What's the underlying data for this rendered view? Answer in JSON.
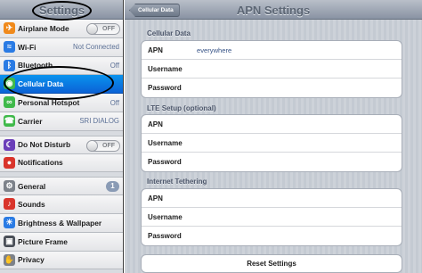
{
  "sidebar": {
    "title": "Settings",
    "items": [
      {
        "label": "Airplane Mode",
        "icon": "airplane-icon",
        "toggle": "OFF"
      },
      {
        "label": "Wi-Fi",
        "icon": "wifi-icon",
        "value": "Not Connected"
      },
      {
        "label": "Bluetooth",
        "icon": "bluetooth-icon",
        "value": "Off"
      },
      {
        "label": "Cellular Data",
        "icon": "cellular-icon",
        "selected": true
      },
      {
        "label": "Personal Hotspot",
        "icon": "hotspot-icon",
        "value": "Off"
      },
      {
        "label": "Carrier",
        "icon": "carrier-icon",
        "value": "SRI DIALOG"
      },
      {
        "label": "Do Not Disturb",
        "icon": "moon-icon",
        "toggle": "OFF"
      },
      {
        "label": "Notifications",
        "icon": "notifications-icon"
      },
      {
        "label": "General",
        "icon": "gear-icon",
        "badge": "1"
      },
      {
        "label": "Sounds",
        "icon": "speaker-icon"
      },
      {
        "label": "Brightness & Wallpaper",
        "icon": "brightness-icon"
      },
      {
        "label": "Picture Frame",
        "icon": "picture-frame-icon"
      },
      {
        "label": "Privacy",
        "icon": "hand-icon"
      }
    ]
  },
  "detail": {
    "title": "APN Settings",
    "back_label": "Cellular Data",
    "sections": [
      {
        "header": "Cellular Data",
        "rows": [
          {
            "label": "APN",
            "value": "everywhere"
          },
          {
            "label": "Username",
            "value": ""
          },
          {
            "label": "Password",
            "value": ""
          }
        ]
      },
      {
        "header": "LTE Setup (optional)",
        "rows": [
          {
            "label": "APN",
            "value": ""
          },
          {
            "label": "Username",
            "value": ""
          },
          {
            "label": "Password",
            "value": ""
          }
        ]
      },
      {
        "header": "Internet Tethering",
        "rows": [
          {
            "label": "APN",
            "value": ""
          },
          {
            "label": "Username",
            "value": ""
          },
          {
            "label": "Password",
            "value": ""
          }
        ]
      }
    ],
    "reset_label": "Reset Settings"
  },
  "colors": {
    "selected": "#0b7be3",
    "annotation": "#000000"
  }
}
